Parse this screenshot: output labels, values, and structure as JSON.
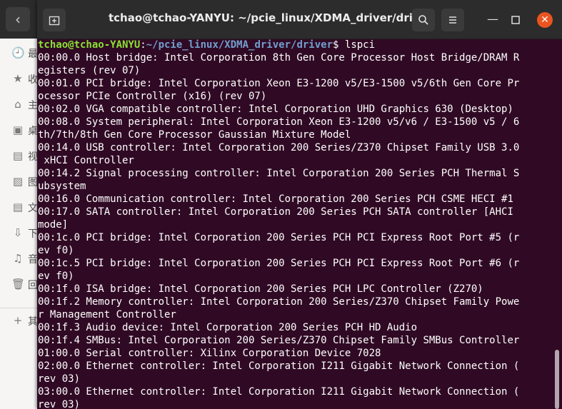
{
  "background_app": {
    "back_icon": "chevron-left-icon",
    "sidebar": [
      {
        "icon": "clock-icon",
        "label": "最"
      },
      {
        "icon": "star-icon",
        "label": "收"
      },
      {
        "icon": "home-icon",
        "label": "主"
      },
      {
        "icon": "desktop-icon",
        "label": "桌"
      },
      {
        "icon": "film-icon",
        "label": "视"
      },
      {
        "icon": "image-icon",
        "label": "图"
      },
      {
        "icon": "document-icon",
        "label": "文"
      },
      {
        "icon": "download-icon",
        "label": "下"
      },
      {
        "icon": "music-icon",
        "label": "音"
      },
      {
        "icon": "trash-icon",
        "label": "回"
      },
      {
        "icon": "plus-icon",
        "label": "其"
      }
    ]
  },
  "terminal": {
    "title": "tchao@tchao-YANYU: ~/pcie_linux/XDMA_driver/driver",
    "prompt": {
      "user_host": "tchao@tchao-YANYU",
      "sep": ":",
      "path": "~/pcie_linux/XDMA_driver/driver",
      "symbol": "$ ",
      "command": "lspci"
    },
    "output": [
      "00:00.0 Host bridge: Intel Corporation 8th Gen Core Processor Host Bridge/DRAM R",
      "egisters (rev 07)",
      "00:01.0 PCI bridge: Intel Corporation Xeon E3-1200 v5/E3-1500 v5/6th Gen Core Pr",
      "ocessor PCIe Controller (x16) (rev 07)",
      "00:02.0 VGA compatible controller: Intel Corporation UHD Graphics 630 (Desktop)",
      "00:08.0 System peripheral: Intel Corporation Xeon E3-1200 v5/v6 / E3-1500 v5 / 6",
      "th/7th/8th Gen Core Processor Gaussian Mixture Model",
      "00:14.0 USB controller: Intel Corporation 200 Series/Z370 Chipset Family USB 3.0",
      " xHCI Controller",
      "00:14.2 Signal processing controller: Intel Corporation 200 Series PCH Thermal S",
      "ubsystem",
      "00:16.0 Communication controller: Intel Corporation 200 Series PCH CSME HECI #1",
      "00:17.0 SATA controller: Intel Corporation 200 Series PCH SATA controller [AHCI",
      "mode]",
      "00:1c.0 PCI bridge: Intel Corporation 200 Series PCH PCI Express Root Port #5 (r",
      "ev f0)",
      "00:1c.5 PCI bridge: Intel Corporation 200 Series PCH PCI Express Root Port #6 (r",
      "ev f0)",
      "00:1f.0 ISA bridge: Intel Corporation 200 Series PCH LPC Controller (Z270)",
      "00:1f.2 Memory controller: Intel Corporation 200 Series/Z370 Chipset Family Powe",
      "r Management Controller",
      "00:1f.3 Audio device: Intel Corporation 200 Series PCH HD Audio",
      "00:1f.4 SMBus: Intel Corporation 200 Series/Z370 Chipset Family SMBus Controller",
      "01:00.0 Serial controller: Xilinx Corporation Device 7028",
      "02:00.0 Ethernet controller: Intel Corporation I211 Gigabit Network Connection (",
      "rev 03)",
      "03:00.0 Ethernet controller: Intel Corporation I211 Gigabit Network Connection (",
      "rev 03)"
    ],
    "titlebar_icons": {
      "new_tab": "new-tab-icon",
      "search": "search-icon",
      "menu": "hamburger-menu-icon",
      "minimize": "minimize-icon",
      "maximize": "maximize-icon",
      "close": "close-icon"
    },
    "colors": {
      "background": "#300a24",
      "prompt_user": "#8ae234",
      "prompt_path": "#729fcf",
      "close_button": "#e95420"
    }
  }
}
